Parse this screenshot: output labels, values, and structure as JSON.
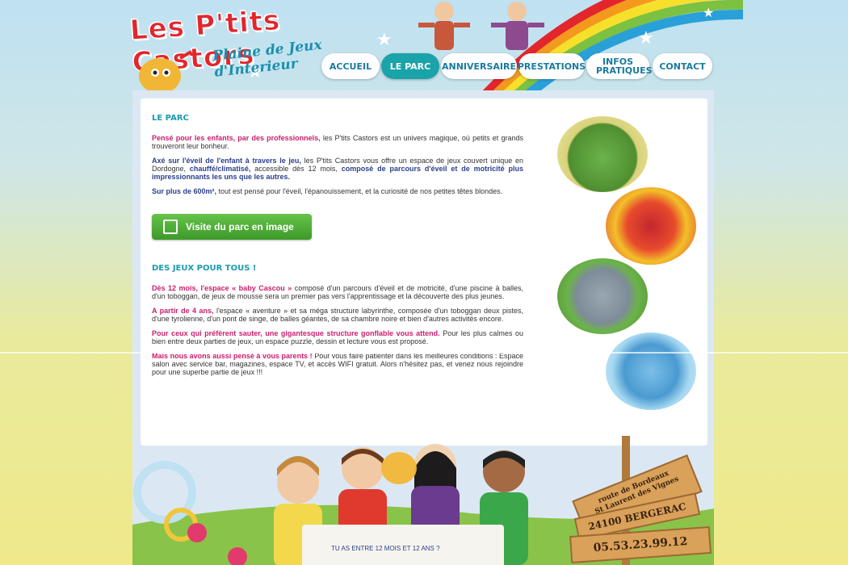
{
  "header": {
    "logo_title": "Les P'tits Castors",
    "logo_subtitle": "Plaine de Jeux d'Interieur",
    "nav": [
      {
        "label": "ACCUEIL",
        "active": false
      },
      {
        "label": "LE PARC",
        "active": true
      },
      {
        "label": "ANNIVERSAIRE",
        "active": false
      },
      {
        "label": "PRESTATIONS",
        "active": false
      },
      {
        "label": "INFOS PRATIQUES",
        "active": false
      },
      {
        "label": "CONTACT",
        "active": false
      }
    ]
  },
  "content": {
    "h1": "LE PARC",
    "p1_strong": "Pensé pour les enfants, par des professionnels,",
    "p1_rest": " les P'tits Castors est un univers magique, où petits et grands trouveront leur bonheur.",
    "p2_strong": "Axé sur l'éveil de l'enfant à travers le jeu,",
    "p2_rest_a": " les P'tits Castors vous offre un espace de jeux couvert unique en Dordogne, ",
    "p2_strong2": "chauffé/climatisé,",
    "p2_rest_b": " accessible dès 12 mois, ",
    "p2_strong3": "composé de parcours d'éveil et de motricité plus impressionnants les uns que les autres.",
    "p3_strong": "Sur plus de 600m²,",
    "p3_rest": " tout est pensé pour l'éveil, l'épanouissement, et la curiosité de nos petites têtes blondes.",
    "button": "Visite du parc en image",
    "h2": "DES JEUX POUR TOUS !",
    "p4_strong": "Dès 12 mois, l'espace « baby Cascou »",
    "p4_rest": " composé d'un parcours d'éveil et de motricité, d'une piscine à balles, d'un toboggan, de jeux de mousse sera un premier pas vers l'apprentissage et la découverte des plus jeunes.",
    "p5_strong": "A partir de 4 ans,",
    "p5_rest": " l'espace « aventure » et sa méga structure labyrinthe, composée d'un toboggan deux pistes, d'une tyrolienne, d'un pont de singe, de balles géantes, de sa chambre noire et bien d'autres activités encore.",
    "p6_strong": "Pour ceux qui préfèrent sauter, une gigantesque structure gonflable vous attend.",
    "p6_rest": " Pour les plus calmes ou bien entre deux parties de jeux, un espace puzzle, dessin et lecture vous est proposé.",
    "p7_strong": "Mais nous avons aussi pensé à vous parents !",
    "p7_rest": " Pour vous faire patienter dans les meilleures conditions : Espace salon avec service bar, magazines, espace TV, et accès WIFI gratuit. Alors n'hésitez pas, et venez nous rejoindre pour une superbe partie de jeux !!!"
  },
  "signpost": {
    "line1": "route de Bordeaux",
    "line2": "St Laurent des Vignes",
    "line3": "24100 BERGERAC",
    "phone": "05.53.23.99.12"
  },
  "bottom": {
    "ask": "TU AS ENTRE 12 MOIS ET 12 ANS ?"
  },
  "colors": {
    "accent": "#1aa3a8",
    "pink": "#cc1d6d",
    "navy": "#2a3f8f",
    "green": "#4aae35"
  }
}
